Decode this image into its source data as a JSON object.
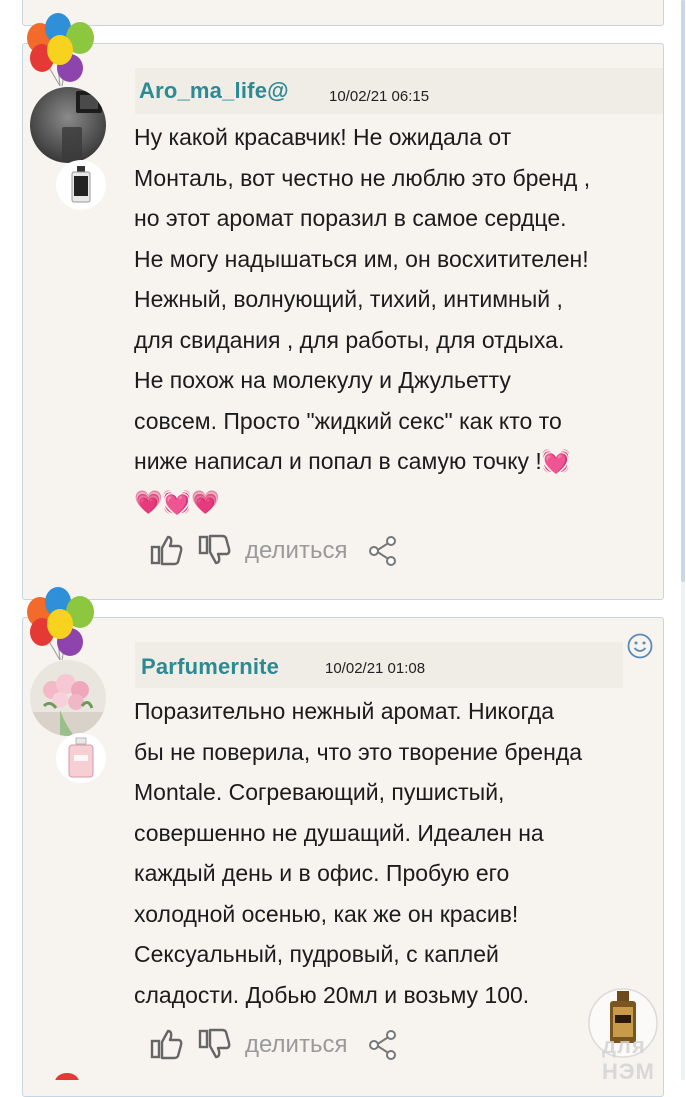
{
  "reviews": [
    {
      "username": "Aro_ma_life@",
      "date": "10/02/21 06:15",
      "text": "Ну какой красавчик! Не ожидала от\nМонталь, вот честно не люблю это бренд ,\nно этот аромат поразил в самое сердце.\nНе могу надышаться им, он восхитителен!\nНежный, волнующий, тихий, интимный ,\nдля свидания , для работы, для отдыха.\nНе похож на молекулу и Джульетту\nсовсем. Просто \"жидкий секс\" как кто то\nниже написал и попал в самую точку !💓\n💗💓💗",
      "share_label": "делиться"
    },
    {
      "username": "Parfumernite",
      "date": "10/02/21 01:08",
      "text": "Поразительно нежный аромат. Никогда\nбы не поверила, что это творение бренда\nMontale. Согревающий, пушистый,\nсовершенно не душащий. Идеален на\nкаждый день и в офис. Пробую его\nхолодной осенью, как же он красив!\nСексуальный, пудровый, с каплей\nсладости. Добью 20мл и возьму 100.",
      "share_label": "делиться"
    }
  ],
  "watermark": "для НЭМ",
  "icons": {
    "like": "thumbs-up-icon",
    "dislike": "thumbs-down-icon",
    "share": "share-icon",
    "smiley": "smiley-icon",
    "balloons": "balloons-icon"
  },
  "colors": {
    "username": "#2b8a93",
    "card_bg": "#f7f3ee",
    "card_border": "#c6d5e3",
    "muted": "#9a9a9a"
  }
}
